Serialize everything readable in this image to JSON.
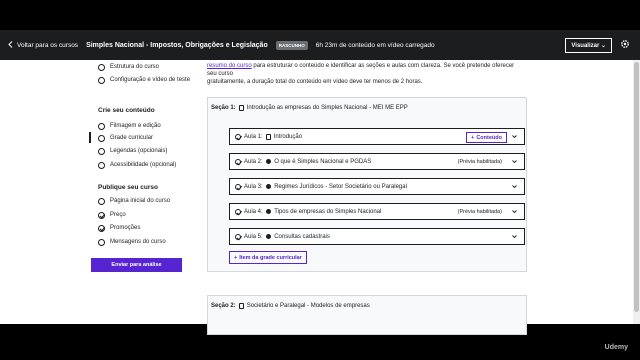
{
  "header": {
    "back_label": "Voltar para os cursos",
    "course_title": "Simples Nacional - Impostos, Obrigações e Legislação",
    "status_badge": "RASCUNHO",
    "duration": "6h 23m de conteúdo em vídeo carregado",
    "view_button": "Visualizar",
    "view_chevron": "⌄"
  },
  "sidebar": {
    "top_items": [
      {
        "label": "Estrutura do curso",
        "state": "radio"
      },
      {
        "label": "Configuração e vídeo de teste",
        "state": "radio"
      }
    ],
    "create_heading": "Crie seu conteúdo",
    "create_items": [
      {
        "label": "Filmagem e edição",
        "state": "radio"
      },
      {
        "label": "Grade curricular",
        "state": "radio",
        "active": true
      },
      {
        "label": "Legendas (opcionais)",
        "state": "radio"
      },
      {
        "label": "Acessibilidade (opcional)",
        "state": "radio"
      }
    ],
    "publish_heading": "Publique seu curso",
    "publish_items": [
      {
        "label": "Página inicial do curso",
        "state": "radio"
      },
      {
        "label": "Preço",
        "state": "check"
      },
      {
        "label": "Promoções",
        "state": "check"
      },
      {
        "label": "Mensagens do curso",
        "state": "radio"
      }
    ],
    "submit_label": "Enviar para análise"
  },
  "main": {
    "intro_line1_link": "resumo do curso",
    "intro_line1_rest": " para estruturar o conteúdo e identificar as seções e aulas com clareza. Se você pretende oferecer seu curso",
    "intro_line2": "gratuitamente, a duração total do conteúdo em vídeo deve ter menos de 2 horas.",
    "section1": {
      "label": "Seção 1:",
      "title": "Introdução as empresas do Simples Nacional - MEI ME EPP",
      "lectures": [
        {
          "label": "Aula 1:",
          "title": "Introdução",
          "icon": "doc",
          "action": "Conteúdo",
          "preview": ""
        },
        {
          "label": "Aula 2:",
          "title": "O que é Simples Nacional e PGDAS",
          "icon": "play",
          "preview": "(Prévia habilitada)"
        },
        {
          "label": "Aula 3:",
          "title": "Regimes Jurídicos - Setor Societário ou Paralegal",
          "icon": "play",
          "preview": ""
        },
        {
          "label": "Aula 4:",
          "title": "Tipos de empresas do Simples Nacional",
          "icon": "play",
          "preview": "(Prévia habilitada)"
        },
        {
          "label": "Aula 5:",
          "title": "Consultas cadastrais",
          "icon": "play",
          "preview": ""
        }
      ],
      "add_item_label": "Item da grade curricular"
    },
    "section2": {
      "label": "Seção 2:",
      "title": "Societário e Paralegal - Modelos de empresas"
    }
  },
  "watermark": "Udemy",
  "colors": {
    "accent": "#5624d0",
    "topbar": "#1c1d1f",
    "text": "#1c1d1f"
  }
}
